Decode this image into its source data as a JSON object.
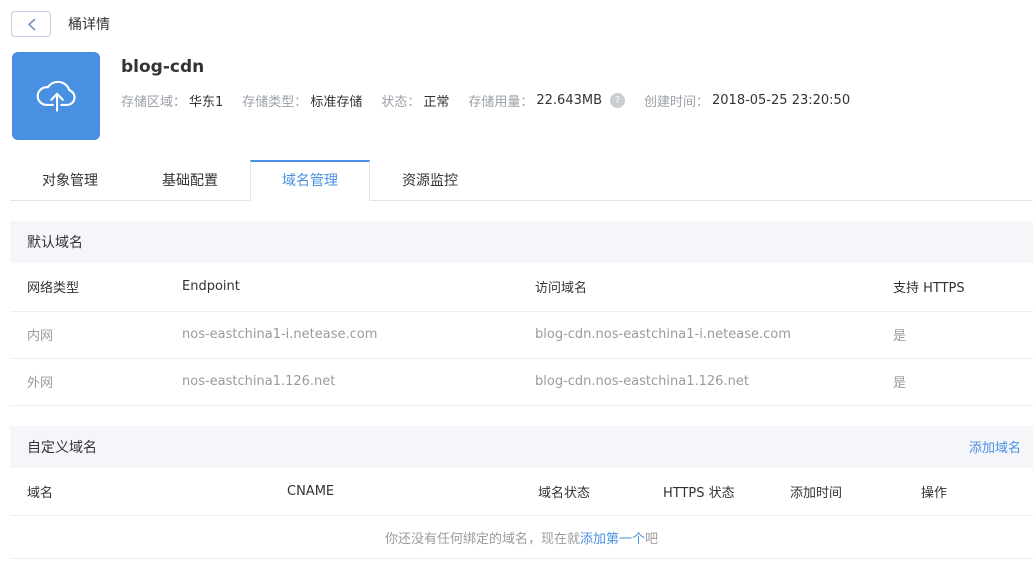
{
  "colors": {
    "accent": "#4a90e2",
    "icon_bg": "#4a90e2",
    "section_bg": "#f4f6f9"
  },
  "topbar": {
    "title": "桶详情"
  },
  "bucket": {
    "name": "blog-cdn",
    "icon": "cloud-upload-icon",
    "info": [
      {
        "label": "存储区域：",
        "value": "华东1"
      },
      {
        "label": "存储类型：",
        "value": "标准存储"
      },
      {
        "label": "状态：",
        "value": "正常"
      },
      {
        "label": "存储用量：",
        "value": "22.643MB"
      },
      {
        "label": "创建时间：",
        "value": "2018-05-25 23:20:50"
      }
    ]
  },
  "tabs": [
    {
      "label": "对象管理",
      "active": false
    },
    {
      "label": "基础配置",
      "active": false
    },
    {
      "label": "域名管理",
      "active": true
    },
    {
      "label": "资源监控",
      "active": false
    }
  ],
  "default_domains": {
    "title": "默认域名",
    "columns": [
      "网络类型",
      "Endpoint",
      "访问域名",
      "支持 HTTPS"
    ],
    "rows": [
      [
        "内网",
        "nos-eastchina1-i.netease.com",
        "blog-cdn.nos-eastchina1-i.netease.com",
        "是"
      ],
      [
        "外网",
        "nos-eastchina1.126.net",
        "blog-cdn.nos-eastchina1.126.net",
        "是"
      ]
    ]
  },
  "custom_domains": {
    "title": "自定义域名",
    "add_button": "添加域名",
    "columns": [
      "域名",
      "CNAME",
      "域名状态",
      "HTTPS 状态",
      "添加时间",
      "操作"
    ],
    "empty_prefix": "你还没有任何绑定的域名，现在就",
    "empty_link": "添加第一个",
    "empty_suffix": "吧"
  }
}
